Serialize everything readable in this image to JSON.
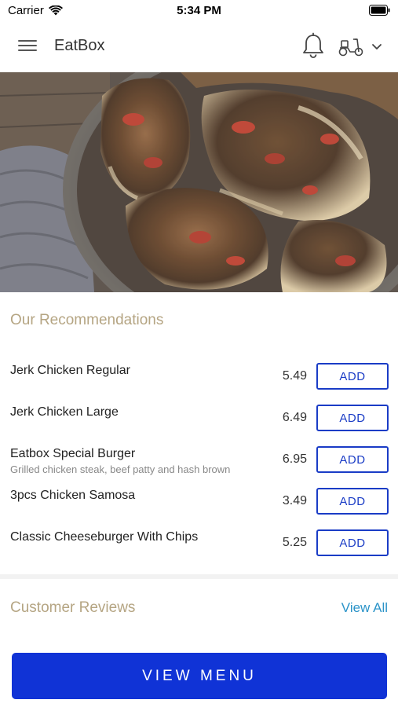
{
  "status": {
    "carrier": "Carrier",
    "time": "5:34 PM"
  },
  "header": {
    "title": "EatBox"
  },
  "recommendations": {
    "title": "Our Recommendations",
    "items": [
      {
        "name": "Jerk Chicken Regular",
        "desc": "",
        "price": "5.49",
        "button": "ADD"
      },
      {
        "name": "Jerk Chicken Large",
        "desc": "",
        "price": "6.49",
        "button": "ADD"
      },
      {
        "name": "Eatbox Special Burger",
        "desc": "Grilled chicken steak, beef patty and hash brown",
        "price": "6.95",
        "button": "ADD"
      },
      {
        "name": "3pcs Chicken Samosa",
        "desc": "",
        "price": "3.49",
        "button": "ADD"
      },
      {
        "name": "Classic Cheeseburger With Chips",
        "desc": "",
        "price": "5.25",
        "button": "ADD"
      }
    ]
  },
  "reviews": {
    "title": "Customer Reviews",
    "view_all": "View All"
  },
  "footer": {
    "view_menu": "VIEW MENU"
  },
  "colors": {
    "accent_blue": "#1033d6",
    "section_title_gold": "#b5a583",
    "link_blue": "#2a93c8"
  }
}
